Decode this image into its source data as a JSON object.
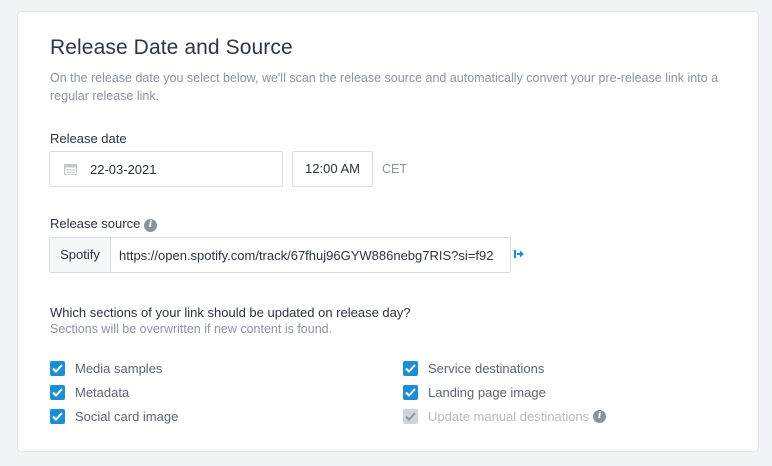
{
  "section": {
    "title": "Release Date and Source",
    "description": "On the release date you select below, we'll scan the release source and automatically convert your pre-release link into a regular release link."
  },
  "release_date": {
    "label": "Release date",
    "date_value": "22-03-2021",
    "time_value": "12:00 AM",
    "timezone": "CET",
    "calendar_icon": "calendar-icon"
  },
  "release_source": {
    "label": "Release source",
    "info_icon": "info-icon",
    "service": "Spotify",
    "url": "https://open.spotify.com/track/67fhuj96GYW886nebg7RIS?si=f92",
    "open_icon": "open-link-icon"
  },
  "sections_update": {
    "question": "Which sections of your link should be updated on release day?",
    "subtext": "Sections will be overwritten if new content is found.",
    "options_left": [
      {
        "label": "Media samples",
        "checked": true,
        "disabled": false
      },
      {
        "label": "Metadata",
        "checked": true,
        "disabled": false
      },
      {
        "label": "Social card image",
        "checked": true,
        "disabled": false
      }
    ],
    "options_right": [
      {
        "label": "Service destinations",
        "checked": true,
        "disabled": false
      },
      {
        "label": "Landing page image",
        "checked": true,
        "disabled": false
      },
      {
        "label": "Update manual destinations",
        "checked": true,
        "disabled": true
      }
    ]
  },
  "colors": {
    "accent": "#1a8fd6",
    "disabled": "#cfd4da",
    "muted_text": "#8b94a2"
  }
}
